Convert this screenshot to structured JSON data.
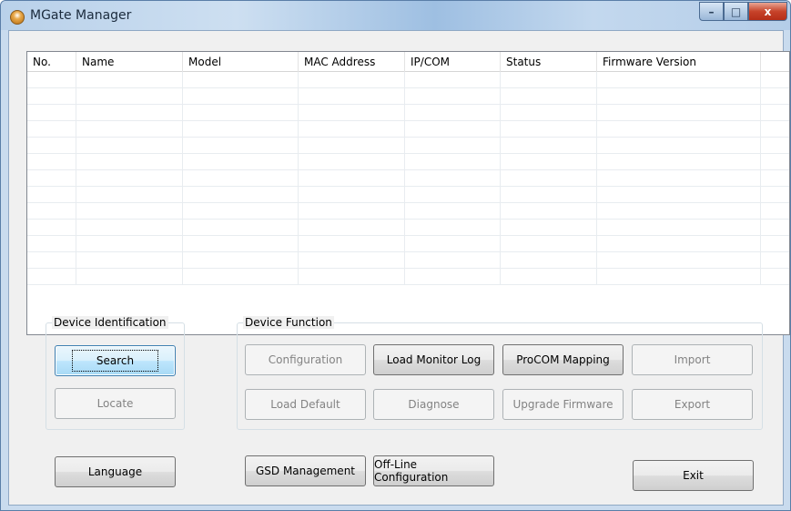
{
  "window": {
    "title": "MGate Manager",
    "controls": {
      "minimize": "–",
      "maximize": "□",
      "close": "x"
    }
  },
  "table": {
    "columns": [
      "No.",
      "Name",
      "Model",
      "MAC Address",
      "IP/COM",
      "Status",
      "Firmware Version"
    ]
  },
  "device_identification": {
    "label": "Device Identification",
    "search": "Search",
    "locate": "Locate"
  },
  "device_function": {
    "label": "Device Function",
    "configuration": "Configuration",
    "load_monitor_log": "Load Monitor Log",
    "procom_mapping": "ProCOM Mapping",
    "import": "Import",
    "load_default": "Load Default",
    "diagnose": "Diagnose",
    "upgrade_firmware": "Upgrade Firmware",
    "export": "Export"
  },
  "bottom": {
    "language": "Language",
    "gsd_management": "GSD Management",
    "offline_configuration": "Off-Line Configuration",
    "exit": "Exit"
  }
}
